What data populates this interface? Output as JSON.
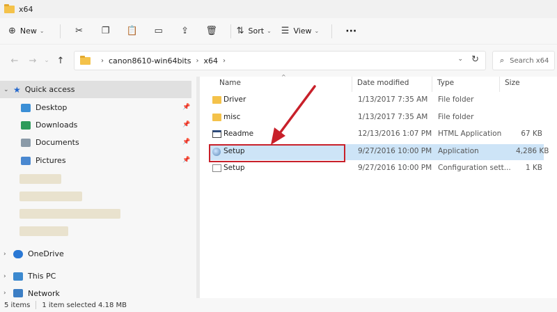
{
  "window": {
    "title": "x64"
  },
  "toolbar": {
    "new_label": "New",
    "sort_label": "Sort",
    "view_label": "View",
    "more_label": "···"
  },
  "address": {
    "path": [
      "canon8610-win64bits",
      "x64"
    ],
    "search_placeholder": "Search x64"
  },
  "sidebar": {
    "items": [
      {
        "label": "Quick access",
        "icon": "star-icon"
      },
      {
        "label": "Desktop",
        "icon": "desktop-icon"
      },
      {
        "label": "Downloads",
        "icon": "downloads-icon"
      },
      {
        "label": "Documents",
        "icon": "documents-icon"
      },
      {
        "label": "Pictures",
        "icon": "pictures-icon"
      },
      {
        "label": "OneDrive",
        "icon": "cloud-icon"
      },
      {
        "label": "This PC",
        "icon": "computer-icon"
      },
      {
        "label": "Network",
        "icon": "network-icon"
      }
    ]
  },
  "columns": {
    "name": "Name",
    "date": "Date modified",
    "type": "Type",
    "size": "Size"
  },
  "files": [
    {
      "name": "Driver",
      "date": "1/13/2017 7:35 AM",
      "type": "File folder",
      "size": "",
      "icon": "folder-icon"
    },
    {
      "name": "misc",
      "date": "1/13/2017 7:35 AM",
      "type": "File folder",
      "size": "",
      "icon": "folder-icon"
    },
    {
      "name": "Readme",
      "date": "12/13/2016 1:07 PM",
      "type": "HTML Application",
      "size": "67 KB",
      "icon": "html-app-icon"
    },
    {
      "name": "Setup",
      "date": "9/27/2016 10:00 PM",
      "type": "Application",
      "size": "4,286 KB",
      "icon": "setup-app-icon",
      "selected": true
    },
    {
      "name": "Setup",
      "date": "9/27/2016 10:00 PM",
      "type": "Configuration sett...",
      "size": "1 KB",
      "icon": "config-file-icon"
    }
  ],
  "status": {
    "count": "5 items",
    "selection": "1 item selected  4.18 MB"
  },
  "colors": {
    "highlight": "#c8202a",
    "selection": "#cde4f7",
    "folder": "#f4c24a"
  }
}
